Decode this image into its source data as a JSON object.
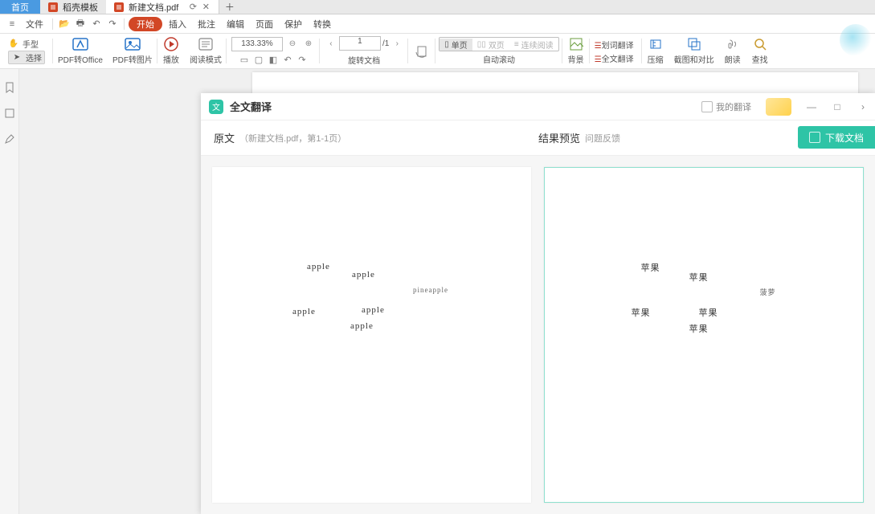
{
  "tabs": {
    "home": "首页",
    "template": "稻壳模板",
    "doc": "新建文档.pdf"
  },
  "menu": {
    "file": "文件",
    "start": "开始",
    "insert": "插入",
    "annotate": "批注",
    "edit": "编辑",
    "page": "页面",
    "protect": "保护",
    "convert": "转换"
  },
  "ribbon": {
    "hand": "手型",
    "select": "选择",
    "pdf_office": "PDF转Office",
    "pdf_image": "PDF转图片",
    "play": "播放",
    "read_mode": "阅读模式",
    "zoom": "133.33%",
    "page_current": "1",
    "page_total": "/1",
    "rotate": "旋转文档",
    "single_page": "单页",
    "double_page": "双页",
    "cont_read": "连续阅读",
    "auto_scroll": "自动滚动",
    "background": "背景",
    "sel_translate": "划词翻译",
    "full_translate": "全文翻译",
    "compress": "压缩",
    "crop_compare": "截图和对比",
    "read_aloud": "朗读",
    "find": "查找"
  },
  "translate_panel": {
    "title": "全文翻译",
    "my_translations": "我的翻译",
    "left_label": "原文",
    "source_file": "（新建文档.pdf，第1-1页）",
    "right_label": "结果预览",
    "feedback": "问题反馈",
    "download": "下载文档"
  },
  "source_words": {
    "w1": "apple",
    "w2": "apple",
    "w3": "pineapple",
    "w4": "apple",
    "w5": "apple",
    "w6": "apple"
  },
  "result_words": {
    "w1": "苹果",
    "w2": "苹果",
    "w3": "菠萝",
    "w4": "苹果",
    "w5": "苹果",
    "w6": "苹果"
  }
}
